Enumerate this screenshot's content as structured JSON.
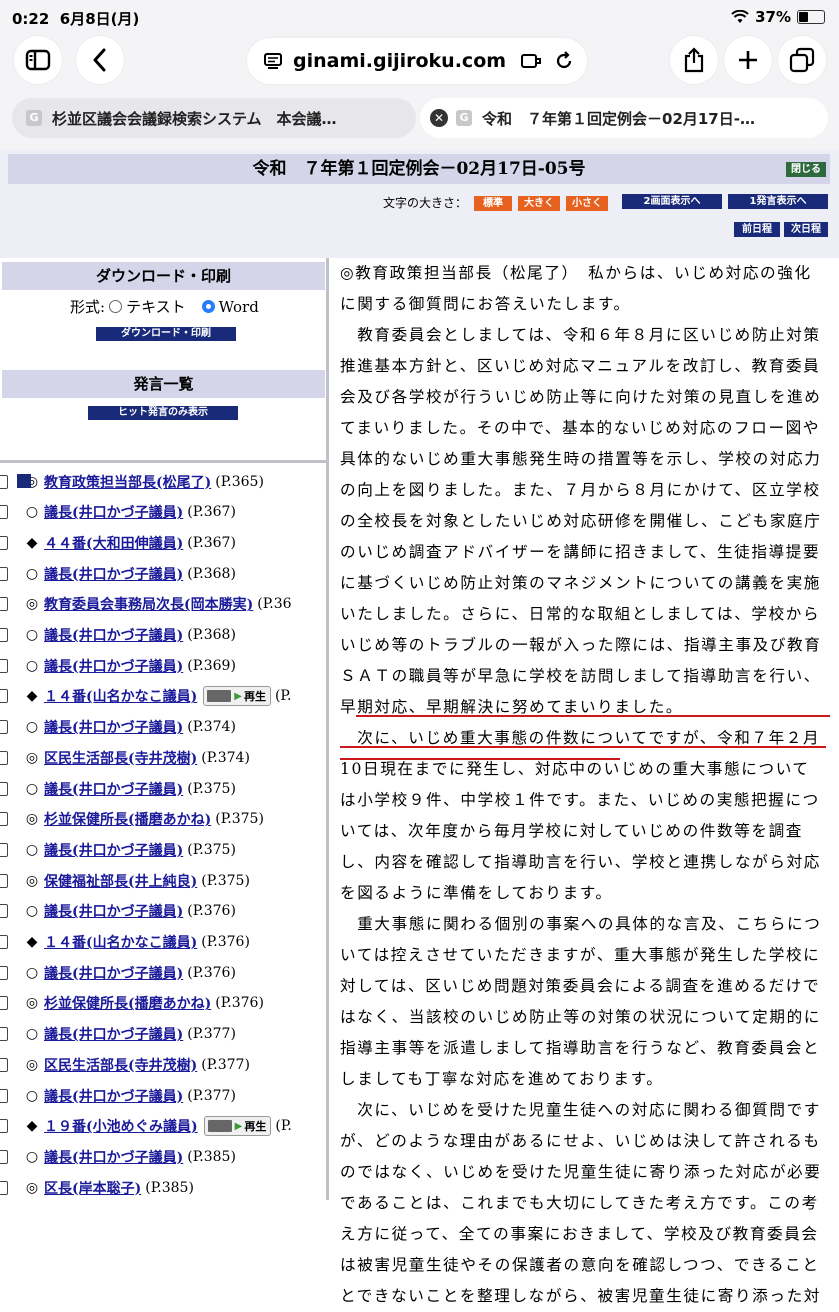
{
  "statusbar": {
    "time": "0:22",
    "date": "6月8日(月)",
    "battery": "37%"
  },
  "browser": {
    "url": "ginami.gijiroku.com",
    "tabs": [
      {
        "label": "杉並区議会会議録検索システム　本会議…"
      },
      {
        "label": "令和　７年第１回定例会－02月17日-…"
      }
    ]
  },
  "header": {
    "title": "令和　７年第１回定例会－02月17日-05号",
    "close_label": "閉じる",
    "font_size_label": "文字の大きさ：",
    "font_sizes": [
      "標準",
      "大きく",
      "小さく"
    ],
    "view_buttons": [
      "2画面表示へ",
      "1発言表示へ"
    ],
    "nav_buttons": [
      "前日程",
      "次日程"
    ]
  },
  "download": {
    "heading": "ダウンロード・印刷",
    "format_label": "形式:",
    "options": [
      "テキスト",
      "Word"
    ],
    "selected": "Word",
    "button": "ダウンロード・印刷"
  },
  "speech_list": {
    "heading": "発言一覧",
    "filter_button": "ヒット発言のみ表示",
    "items": [
      {
        "mark": "◎",
        "name": "教育政策担当部長(松尾了)",
        "page": "(P.365)",
        "play": false,
        "current": true
      },
      {
        "mark": "○",
        "name": "議長(井口かづ子議員)",
        "page": "(P.367)",
        "play": false
      },
      {
        "mark": "◆",
        "name": "４４番(大和田伸議員)",
        "page": "(P.367)",
        "play": false
      },
      {
        "mark": "○",
        "name": "議長(井口かづ子議員)",
        "page": "(P.368)",
        "play": false
      },
      {
        "mark": "◎",
        "name": "教育委員会事務局次長(岡本勝実)",
        "page": "(P.36",
        "play": false
      },
      {
        "mark": "○",
        "name": "議長(井口かづ子議員)",
        "page": "(P.368)",
        "play": false
      },
      {
        "mark": "○",
        "name": "議長(井口かづ子議員)",
        "page": "(P.369)",
        "play": false
      },
      {
        "mark": "◆",
        "name": "１４番(山名かなこ議員)",
        "page": "(P.",
        "play": true
      },
      {
        "mark": "○",
        "name": "議長(井口かづ子議員)",
        "page": "(P.374)",
        "play": false
      },
      {
        "mark": "◎",
        "name": "区民生活部長(寺井茂樹)",
        "page": "(P.374)",
        "play": false
      },
      {
        "mark": "○",
        "name": "議長(井口かづ子議員)",
        "page": "(P.375)",
        "play": false
      },
      {
        "mark": "◎",
        "name": "杉並保健所長(播磨あかね)",
        "page": "(P.375)",
        "play": false
      },
      {
        "mark": "○",
        "name": "議長(井口かづ子議員)",
        "page": "(P.375)",
        "play": false
      },
      {
        "mark": "◎",
        "name": "保健福祉部長(井上純良)",
        "page": "(P.375)",
        "play": false
      },
      {
        "mark": "○",
        "name": "議長(井口かづ子議員)",
        "page": "(P.376)",
        "play": false
      },
      {
        "mark": "◆",
        "name": "１４番(山名かなこ議員)",
        "page": "(P.376)",
        "play": false
      },
      {
        "mark": "○",
        "name": "議長(井口かづ子議員)",
        "page": "(P.376)",
        "play": false
      },
      {
        "mark": "◎",
        "name": "杉並保健所長(播磨あかね)",
        "page": "(P.376)",
        "play": false
      },
      {
        "mark": "○",
        "name": "議長(井口かづ子議員)",
        "page": "(P.377)",
        "play": false
      },
      {
        "mark": "◎",
        "name": "区民生活部長(寺井茂樹)",
        "page": "(P.377)",
        "play": false
      },
      {
        "mark": "○",
        "name": "議長(井口かづ子議員)",
        "page": "(P.377)",
        "play": false
      },
      {
        "mark": "◆",
        "name": "１９番(小池めぐみ議員)",
        "page": "(P.",
        "play": true
      },
      {
        "mark": "○",
        "name": "議長(井口かづ子議員)",
        "page": "(P.385)",
        "play": false
      },
      {
        "mark": "◎",
        "name": "区長(岸本聡子)",
        "page": "(P.385)",
        "play": false
      }
    ],
    "play_label": "再生"
  },
  "transcript": {
    "lines": [
      "◎教育政策担当部長（松尾了）　私からは、いじめ対応の強化",
      "に関する御質問にお答えいたします。",
      "　教育委員会としましては、令和６年８月に区いじめ防止対策",
      "推進基本方針と、区いじめ対応マニュアルを改訂し、教育委員",
      "会及び各学校が行ういじめ防止等に向けた対策の見直しを進め",
      "てまいりました。その中で、基本的ないじめ対応のフロー図や",
      "具体的ないじめ重大事態発生時の措置等を示し、学校の対応力",
      "の向上を図りました。また、７月から８月にかけて、区立学校",
      "の全校長を対象としたいじめ対応研修を開催し、こども家庭庁",
      "のいじめ調査アドバイザーを講師に招きまして、生徒指導提要",
      "に基づくいじめ防止対策のマネジメントについての講義を実施",
      "いたしました。さらに、日常的な取組としましては、学校から",
      "いじめ等のトラブルの一報が入った際には、指導主事及び教育",
      "ＳＡＴの職員等が早急に学校を訪問しまして指導助言を行い、",
      "早期対応、早期解決に努めてまいりました。",
      "　次に、いじめ重大事態の件数についてですが、令和７年２月",
      "10日現在までに発生し、対応中のいじめの重大事態について",
      "は小学校９件、中学校１件です。また、いじめの実態把握につ",
      "いては、次年度から毎月学校に対していじめの件数等を調査",
      "し、内容を確認して指導助言を行い、学校と連携しながら対応",
      "を図るように準備をしております。",
      "　重大事態に関わる個別の事案への具体的な言及、こちらにつ",
      "いては控えさせていただきますが、重大事態が発生した学校に",
      "対しては、区いじめ問題対策委員会による調査を進めるだけで",
      "はなく、当該校のいじめ防止等の対策の状況について定期的に",
      "指導主事等を派遣しまして指導助言を行うなど、教育委員会と",
      "しましても丁寧な対応を進めております。",
      "　次に、いじめを受けた児童生徒への対応に関わる御質問です",
      "が、どのような理由があるにせよ、いじめは決して許されるも",
      "のではなく、いじめを受けた児童生徒に寄り添った対応が必要",
      "であることは、これまでも大切にしてきた考え方です。この考",
      "え方に従って、全ての事案におきまして、学校及び教育委員会",
      "は被害児童生徒やその保護者の意向を確認しつつ、できること",
      "とできないことを整理しながら、被害児童生徒に寄り添った対"
    ]
  }
}
